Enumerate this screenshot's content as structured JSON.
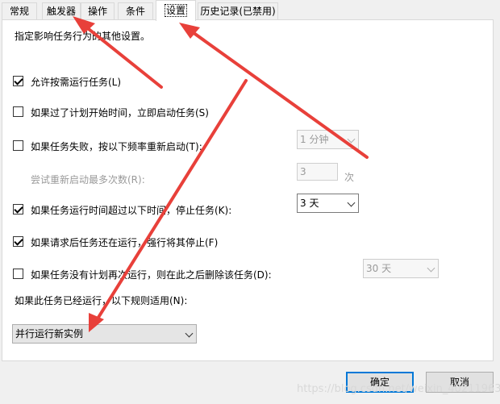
{
  "tabs": [
    "常规",
    "触发器",
    "操作",
    "条件",
    "设置",
    "历史记录(已禁用)"
  ],
  "active_tab": "设置",
  "intro": "指定影响任务行为的其他设置。",
  "options": {
    "allow_on_demand": "允许按需运行任务(L)",
    "run_if_missed": "如果过了计划开始时间，立即启动任务(S)",
    "restart_on_fail": "如果任务失败，按以下频率重新启动(T):",
    "restart_attempts": "尝试重新启动最多次数(R):",
    "stop_if_long": "如果任务运行时间超过以下时间，停止任务(K):",
    "force_stop": "如果请求后任务还在运行，强行将其停止(F)",
    "delete_if_unscheduled": "如果任务没有计划再次运行，则在此之后删除该任务(D):",
    "rule_label": "如果此任务已经运行，以下规则适用(N):"
  },
  "values": {
    "restart_interval": "1 分钟",
    "restart_count": "3",
    "restart_count_unit": "次",
    "stop_after": "3 天",
    "delete_after": "30 天",
    "rule": "并行运行新实例"
  },
  "checked": {
    "allow_on_demand": true,
    "run_if_missed": false,
    "restart_on_fail": false,
    "stop_if_long": true,
    "force_stop": true,
    "delete_if_unscheduled": false
  },
  "buttons": {
    "ok": "确定",
    "cancel": "取消"
  },
  "watermark": "https://blog.csdn.net/weixin_40211963",
  "colors": {
    "arrow": "#e8403a",
    "accent": "#0078d7"
  }
}
